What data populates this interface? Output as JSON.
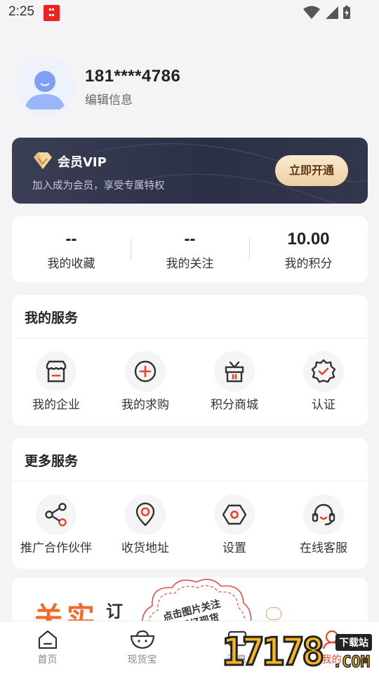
{
  "status_bar": {
    "time": "2:25"
  },
  "profile": {
    "phone": "181****4786",
    "edit_label": "编辑信息"
  },
  "vip": {
    "title": "会员VIP",
    "description": "加入成为会员，享受专属特权",
    "button_label": "立即开通"
  },
  "stats": [
    {
      "value": "--",
      "label": "我的收藏"
    },
    {
      "value": "--",
      "label": "我的关注"
    },
    {
      "value": "10.00",
      "label": "我的积分"
    }
  ],
  "my_services": {
    "title": "我的服务",
    "items": [
      {
        "label": "我的企业",
        "icon": "store-icon"
      },
      {
        "label": "我的求购",
        "icon": "plus-circle-icon"
      },
      {
        "label": "积分商城",
        "icon": "gift-icon"
      },
      {
        "label": "认证",
        "icon": "verified-badge-icon"
      }
    ]
  },
  "more_services": {
    "title": "更多服务",
    "items": [
      {
        "label": "推广合作伙伴",
        "icon": "share-icon"
      },
      {
        "label": "收货地址",
        "icon": "location-pin-icon"
      },
      {
        "label": "设置",
        "icon": "settings-hex-icon"
      },
      {
        "label": "在线客服",
        "icon": "headset-icon"
      }
    ]
  },
  "banner": {
    "brand_text": "关实",
    "side_text": "订",
    "cloud_line1": "点击图片关注",
    "cloud_line2": "请看经现货"
  },
  "tab_bar": {
    "tabs": [
      {
        "label": "首页",
        "icon": "home-icon"
      },
      {
        "label": "现货宝",
        "icon": "basket-icon"
      },
      {
        "label": "消息",
        "icon": "message-icon"
      },
      {
        "label": "我的",
        "icon": "user-icon"
      }
    ]
  },
  "watermark": {
    "text": "17178",
    "suffix": ".COM",
    "tag": "下载站"
  },
  "colors": {
    "accent": "#e8452a",
    "vip_gold": "#eed3a5",
    "vip_dark": "#2f3349"
  }
}
